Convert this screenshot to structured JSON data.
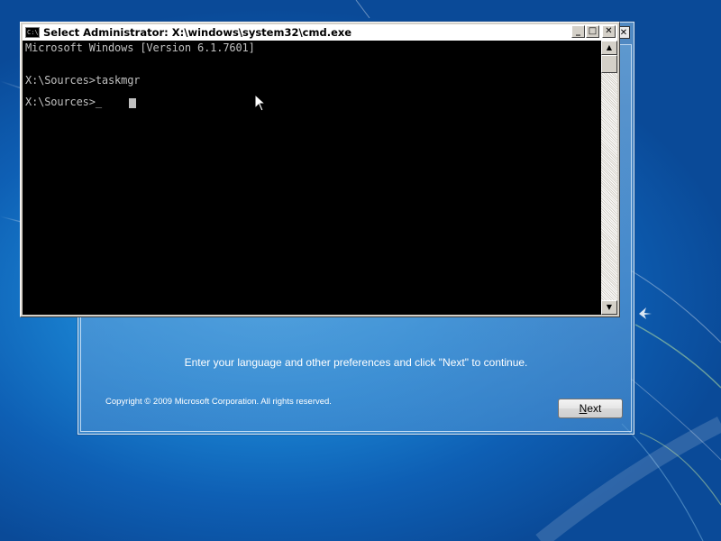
{
  "cmd": {
    "title": "Select Administrator: X:\\windows\\system32\\cmd.exe",
    "icon_label": "C:\\",
    "controls": {
      "minimize": "_",
      "maximize": "□",
      "close": "✕"
    },
    "lines": [
      "Microsoft Windows [Version 6.1.7601]",
      "",
      "X:\\Sources>taskmgr",
      "",
      "X:\\Sources>_"
    ],
    "scroll_up": "▲",
    "scroll_down": "▼"
  },
  "setup": {
    "close_label": "✕",
    "instruction": "Enter your language and other preferences and click \"Next\" to continue.",
    "copyright": "Copyright © 2009 Microsoft Corporation. All rights reserved.",
    "next_button": {
      "mnemonic": "N",
      "rest": "ext"
    }
  }
}
